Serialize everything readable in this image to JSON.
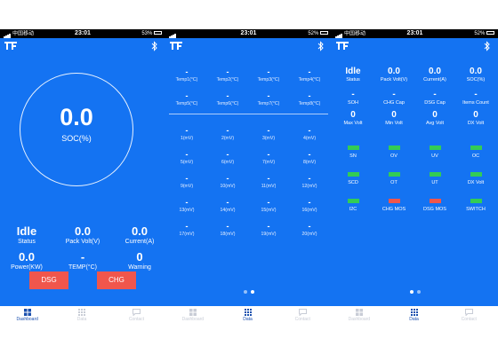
{
  "status_bars": [
    {
      "carrier": "中国移动",
      "time": "23:01",
      "battery": "53%"
    },
    {
      "carrier": "",
      "time": "23:01",
      "battery": "52%"
    },
    {
      "carrier": "中国移动",
      "time": "23:01",
      "battery": "52%"
    }
  ],
  "tabs": [
    {
      "label": "Dashboard",
      "icon": "dashboard-icon"
    },
    {
      "label": "Data",
      "icon": "data-grid-icon"
    },
    {
      "label": "Contact",
      "icon": "chat-icon"
    }
  ],
  "screen1": {
    "soc_value": "0.0",
    "soc_label": "SOC(%)",
    "stats": [
      {
        "value": "Idle",
        "label": "Status"
      },
      {
        "value": "0.0",
        "label": "Pack Volt(V)"
      },
      {
        "value": "0.0",
        "label": "Current(A)"
      },
      {
        "value": "0.0",
        "label": "Power(KW)"
      },
      {
        "value": "-",
        "label": "TEMP(°C)"
      },
      {
        "value": "0",
        "label": "Warning"
      }
    ],
    "dsg_label": "DSG",
    "chg_label": "CHG"
  },
  "screen2": {
    "temps": [
      {
        "value": "-",
        "label": "Temp1(°C)"
      },
      {
        "value": "-",
        "label": "Temp2(°C)"
      },
      {
        "value": "-",
        "label": "Temp3(°C)"
      },
      {
        "value": "-",
        "label": "Temp4(°C)"
      },
      {
        "value": "-",
        "label": "Temp5(°C)"
      },
      {
        "value": "-",
        "label": "Temp6(°C)"
      },
      {
        "value": "-",
        "label": "Temp7(°C)"
      },
      {
        "value": "-",
        "label": "Temp8(°C)"
      }
    ],
    "cells": [
      {
        "value": "-",
        "label": "1(mV)"
      },
      {
        "value": "-",
        "label": "2(mV)"
      },
      {
        "value": "-",
        "label": "3(mV)"
      },
      {
        "value": "-",
        "label": "4(mV)"
      },
      {
        "value": "-",
        "label": "5(mV)"
      },
      {
        "value": "-",
        "label": "6(mV)"
      },
      {
        "value": "-",
        "label": "7(mV)"
      },
      {
        "value": "-",
        "label": "8(mV)"
      },
      {
        "value": "-",
        "label": "9(mV)"
      },
      {
        "value": "-",
        "label": "10(mV)"
      },
      {
        "value": "-",
        "label": "11(mV)"
      },
      {
        "value": "-",
        "label": "12(mV)"
      },
      {
        "value": "-",
        "label": "13(mV)"
      },
      {
        "value": "-",
        "label": "14(mV)"
      },
      {
        "value": "-",
        "label": "15(mV)"
      },
      {
        "value": "-",
        "label": "16(mV)"
      },
      {
        "value": "-",
        "label": "17(mV)"
      },
      {
        "value": "-",
        "label": "18(mV)"
      },
      {
        "value": "-",
        "label": "19(mV)"
      },
      {
        "value": "-",
        "label": "20(mV)"
      }
    ]
  },
  "screen3": {
    "stats": [
      {
        "value": "Idle",
        "label": "Status"
      },
      {
        "value": "0.0",
        "label": "Pack Volt(V)"
      },
      {
        "value": "0.0",
        "label": "Current(A)"
      },
      {
        "value": "0.0",
        "label": "SOC(%)"
      },
      {
        "value": "-",
        "label": "SOH"
      },
      {
        "value": "-",
        "label": "CHG Cap"
      },
      {
        "value": "-",
        "label": "DSG Cap"
      },
      {
        "value": "-",
        "label": "Items Count"
      },
      {
        "value": "0",
        "label": "Max Volt"
      },
      {
        "value": "0",
        "label": "Min Volt"
      },
      {
        "value": "0",
        "label": "Avg Volt"
      },
      {
        "value": "0",
        "label": "DX Volt"
      }
    ],
    "indicators": [
      {
        "label": "SN",
        "color": "#33CC55"
      },
      {
        "label": "OV",
        "color": "#33CC55"
      },
      {
        "label": "UV",
        "color": "#33CC55"
      },
      {
        "label": "OC",
        "color": "#33CC55"
      },
      {
        "label": "SCD",
        "color": "#33CC55"
      },
      {
        "label": "OT",
        "color": "#33CC55"
      },
      {
        "label": "UT",
        "color": "#33CC55"
      },
      {
        "label": "DX Volt",
        "color": "#33CC55"
      },
      {
        "label": "I2C",
        "color": "#33CC55"
      },
      {
        "label": "CHG MOS",
        "color": "#F0564C"
      },
      {
        "label": "DSG MOS",
        "color": "#F0564C"
      },
      {
        "label": "SWITCH",
        "color": "#33CC55"
      }
    ]
  },
  "colors": {
    "background": "#1473F2",
    "button": "#F0564C",
    "ok": "#33CC55",
    "fault": "#F0564C"
  }
}
